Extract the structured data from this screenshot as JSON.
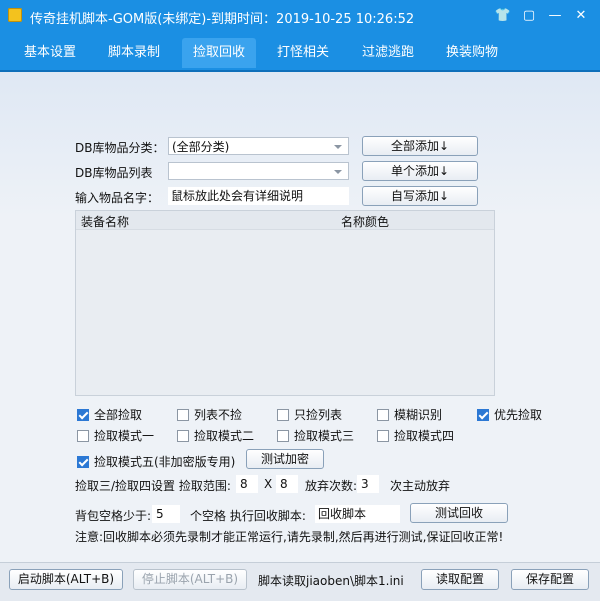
{
  "window": {
    "title": "传奇挂机脚本-GOM版(未绑定)-到期时间：2019-10-25 10:26:52",
    "controls": [
      "👕",
      "▢",
      "—",
      "✕"
    ]
  },
  "tabs": [
    {
      "label": "基本设置",
      "active": false
    },
    {
      "label": "脚本录制",
      "active": false
    },
    {
      "label": "捡取回收",
      "active": true
    },
    {
      "label": "打怪相关",
      "active": false
    },
    {
      "label": "过滤逃跑",
      "active": false
    },
    {
      "label": "换装购物",
      "active": false
    }
  ],
  "pickup": {
    "db_category_label": "DB库物品分类：",
    "db_category_value": "(全部分类)",
    "add_all": "全部添加↓",
    "db_list_label": "DB库物品列表",
    "db_list_value": "",
    "add_single": "单个添加↓",
    "item_name_label": "输入物品名字：",
    "item_name_value": "鼠标放此处会有详细说明",
    "add_custom": "自写添加↓"
  },
  "table": {
    "columns": [
      "装备名称",
      "名称颜色"
    ],
    "rows": []
  },
  "options": {
    "row1": [
      {
        "label": "全部捡取",
        "checked": true
      },
      {
        "label": "列表不捡",
        "checked": false
      },
      {
        "label": "只捡列表",
        "checked": false
      },
      {
        "label": "模糊识别",
        "checked": false
      },
      {
        "label": "优先捡取",
        "checked": true
      }
    ],
    "row2": [
      {
        "label": "捡取模式一",
        "checked": false
      },
      {
        "label": "捡取模式二",
        "checked": false
      },
      {
        "label": "捡取模式三",
        "checked": false
      },
      {
        "label": "捡取模式四",
        "checked": false
      }
    ],
    "mode5": {
      "label": "捡取模式五(非加密版专用)",
      "checked": true
    },
    "test_encrypt": "测试加密"
  },
  "range": {
    "label": "捡取三/捡取四设置 捡取范围:",
    "x_value": "8",
    "x_sep": "X",
    "y_value": "8",
    "giveup_label": "放弃次数:",
    "giveup_value": "3",
    "giveup_suffix": "次主动放弃"
  },
  "recycle": {
    "bag_label": "背包空格少于:",
    "bag_value": "5",
    "exec_label": "个空格 执行回收脚本:",
    "script_value": "回收脚本",
    "test_button": "测试回收",
    "note": "注意:回收脚本必须先录制才能正常运行,请先录制,然后再进行测试,保证回收正常!"
  },
  "statusbar": {
    "start": "启动脚本(ALT+B)",
    "stop": "停止脚本(ALT+B)",
    "read_info": "脚本读取jiaoben\\脚本1.ini",
    "load": "读取配置",
    "save": "保存配置"
  }
}
